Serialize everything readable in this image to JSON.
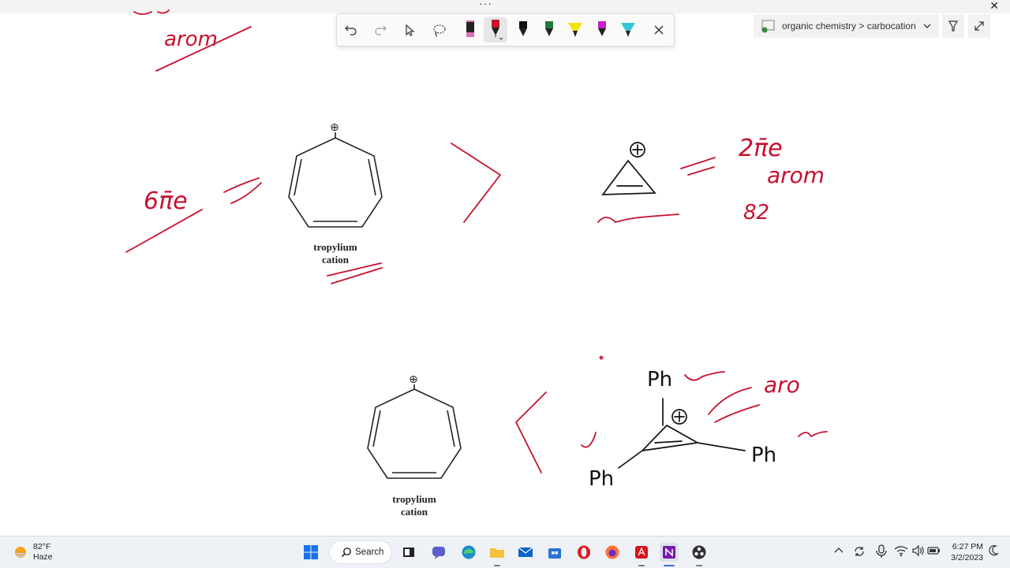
{
  "window": {
    "menu_dots": "···",
    "close_glyph": "✕"
  },
  "notebook": {
    "breadcrumb": "organic chemistry > carbocation"
  },
  "diagram": {
    "label1_line1": "tropylium",
    "label1_line2": "cation",
    "label2_line1": "tropylium",
    "label2_line2": "cation",
    "plus": "⊕",
    "ph_top": "Ph",
    "ph_left": "Ph",
    "ph_right": "Ph",
    "ink_aro_top": "arom",
    "ink_6pi": "6π̄e",
    "ink_2pi": "2π̄e",
    "ink_arom": "arom",
    "ink_82": "82",
    "ink_aro": "aro"
  },
  "pen_colors": {
    "ink": "#c8102e",
    "pen1": "#d96fb6",
    "pen2": "#c8102e",
    "pen3": "#111111",
    "pen4": "#1d7a3a",
    "pen5": "#f5e400",
    "pen6": "#c81fc8",
    "pen7": "#35c7d8"
  },
  "taskbar": {
    "temperature": "82°F",
    "condition": "Haze",
    "search_label": "Search",
    "time": "6:27 PM",
    "date": "3/2/2023"
  }
}
